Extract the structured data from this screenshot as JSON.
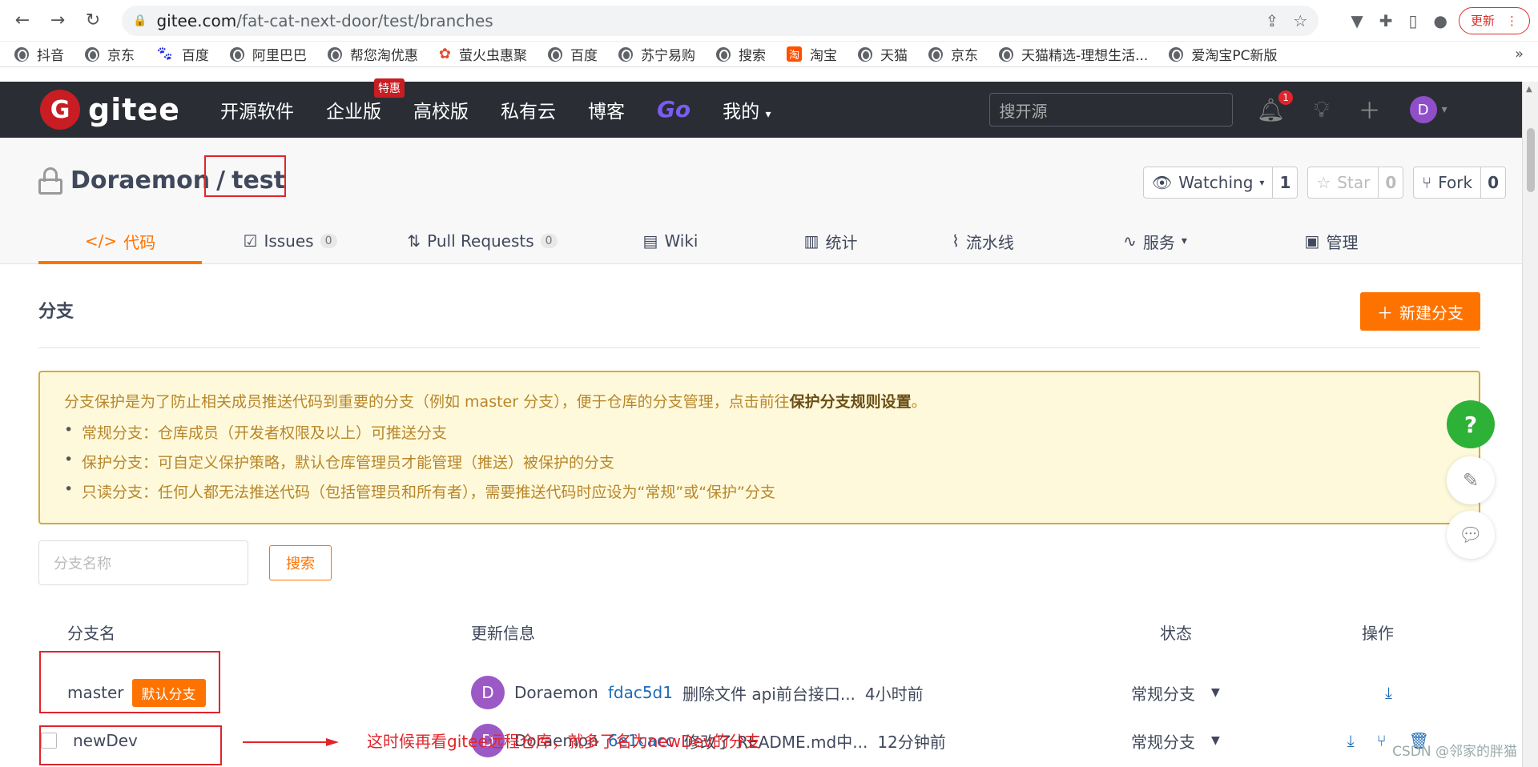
{
  "browser": {
    "url_host": "gitee.com",
    "url_path": "/fat-cat-next-door/test/branches",
    "update_label": "更新"
  },
  "bookmarks": [
    "抖音",
    "京东",
    "百度",
    "阿里巴巴",
    "帮您淘优惠",
    "萤火虫惠聚",
    "百度",
    "苏宁易购",
    "搜索",
    "淘宝",
    "天猫",
    "京东",
    "天猫精选-理想生活...",
    "爱淘宝PC新版"
  ],
  "gitee": {
    "logo_letter": "G",
    "logo_text": "gitee",
    "nav": [
      "开源软件",
      "企业版",
      "高校版",
      "私有云",
      "博客"
    ],
    "hot_badge": "特惠",
    "go_label": "Go",
    "my_label": "我的",
    "search_placeholder": "搜开源",
    "notif_count": "1",
    "avatar_letter": "D"
  },
  "repo": {
    "owner": "Doraemon",
    "separator": "/",
    "name": "test",
    "watching_label": "Watching",
    "watching_count": "1",
    "star_label": "Star",
    "star_count": "0",
    "fork_label": "Fork",
    "fork_count": "0"
  },
  "tabs": {
    "code": "代码",
    "issues": "Issues",
    "issues_count": "0",
    "pulls": "Pull Requests",
    "pulls_count": "0",
    "wiki": "Wiki",
    "stats": "统计",
    "pipeline": "流水线",
    "service": "服务",
    "manage": "管理"
  },
  "branches": {
    "title": "分支",
    "new_branch_label": "新建分支",
    "notice_intro": "分支保护是为了防止相关成员推送代码到重要的分支（例如 master 分支），便于仓库的分支管理，点击前往",
    "notice_link": "保护分支规则设置",
    "notice_end": "。",
    "notice_items": [
      "常规分支：仓库成员（开发者权限及以上）可推送分支",
      "保护分支：可自定义保护策略，默认仓库管理员才能管理（推送）被保护的分支",
      "只读分支：任何人都无法推送代码（包括管理员和所有者），需要推送代码时应设为“常规”或“保护”分支"
    ],
    "search_placeholder": "分支名称",
    "search_button": "搜索",
    "headers": {
      "name": "分支名",
      "info": "更新信息",
      "status": "状态",
      "ops": "操作"
    },
    "rows": [
      {
        "name": "master",
        "default_badge": "默认分支",
        "avatar": "D",
        "author": "Doraemon",
        "sha": "fdac5d1",
        "message": "删除文件 api前台接口...",
        "time": "4小时前",
        "status": "常规分支"
      },
      {
        "name": "newDev",
        "avatar": "D",
        "author": "Doraemon",
        "sha": "6e1cacc",
        "message": "修改了 README.md中...",
        "time": "12分钟前",
        "status": "常规分支"
      }
    ]
  },
  "annotation": {
    "text": "这时候再看gitee远程仓库，就多了名为newDev的分支"
  },
  "float": {
    "help": "?"
  },
  "watermark": "CSDN @邻家的胖猫",
  "colors": {
    "accent": "#fe7300",
    "header_bg": "#2a2d34",
    "gitee_red": "#c71d23",
    "annotation_red": "#e0252b"
  }
}
